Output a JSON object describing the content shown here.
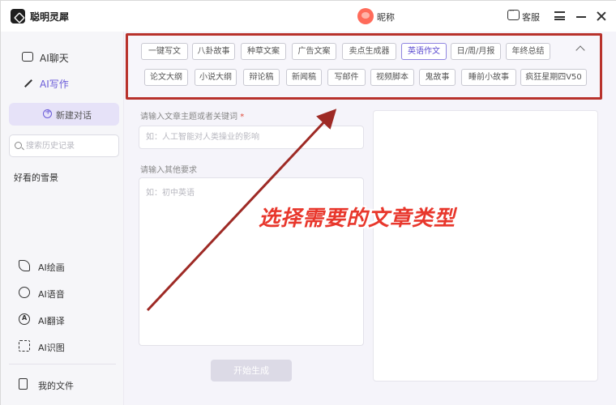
{
  "app": {
    "title": "聪明灵犀"
  },
  "header": {
    "user_name": "昵称",
    "customer_service": "客服"
  },
  "sidebar": {
    "nav": [
      {
        "label": "AI聊天",
        "icon": "chat-icon",
        "active": false
      },
      {
        "label": "AI写作",
        "icon": "pen-icon",
        "active": true
      }
    ],
    "new_chat": "新建对话",
    "search_placeholder": "搜索历史记录",
    "history": [
      "好看的雪景"
    ],
    "tools": [
      {
        "label": "AI绘画",
        "icon": "brush-icon"
      },
      {
        "label": "AI语音",
        "icon": "voice-icon"
      },
      {
        "label": "AI翻译",
        "icon": "translate-icon"
      },
      {
        "label": "AI识图",
        "icon": "image-scan-icon"
      }
    ],
    "my_files": "我的文件"
  },
  "article_types": {
    "row1": [
      "一键写文",
      "八卦故事",
      "种草文案",
      "广告文案",
      "卖点生成器",
      "英语作文",
      "日/周/月报",
      "年终总结"
    ],
    "row2": [
      "论文大纲",
      "小说大纲",
      "辩论稿",
      "新闻稿",
      "写邮件",
      "视频脚本",
      "鬼故事",
      "睡前小故事",
      "疯狂星期四V50"
    ],
    "selected": "英语作文"
  },
  "form": {
    "topic_label": "请输入文章主题或者关键词",
    "required_mark": "*",
    "topic_placeholder": "如：人工智能对人类操业的影响",
    "requirements_label": "请输入其他要求",
    "requirements_placeholder": "如：初中英语",
    "generate_button": "开始生成"
  },
  "annotation": {
    "text": "选择需要的文章类型",
    "color": "#e8372c"
  },
  "colors": {
    "accent": "#6a5bd8",
    "highlight_border": "#b8322c",
    "sidebar_bg": "#f6f6f9"
  }
}
